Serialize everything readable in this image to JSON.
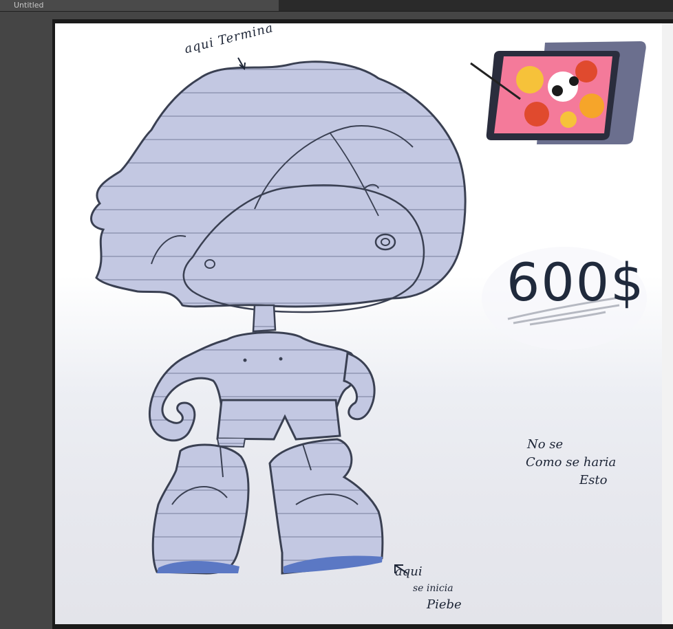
{
  "window": {
    "tab_title": "Untitled"
  },
  "canvas": {
    "note_top": "aqui Termina",
    "price": "600$",
    "note_right": [
      "No se",
      "Como se haria",
      "Esto"
    ],
    "note_bottom": [
      "aqui",
      "se inicia",
      "Piebe"
    ]
  },
  "icons": {
    "tablet_image": "drawing-tablet-image",
    "top_arrow": "arrow-down-icon",
    "bottom_arrow": "arrow-up-left-icon"
  },
  "colors": {
    "sketch_fill": "#c3c8e2",
    "sketch_line": "#3a4052",
    "shoe_sole": "#5b78c4",
    "ink": "#1d2536"
  }
}
